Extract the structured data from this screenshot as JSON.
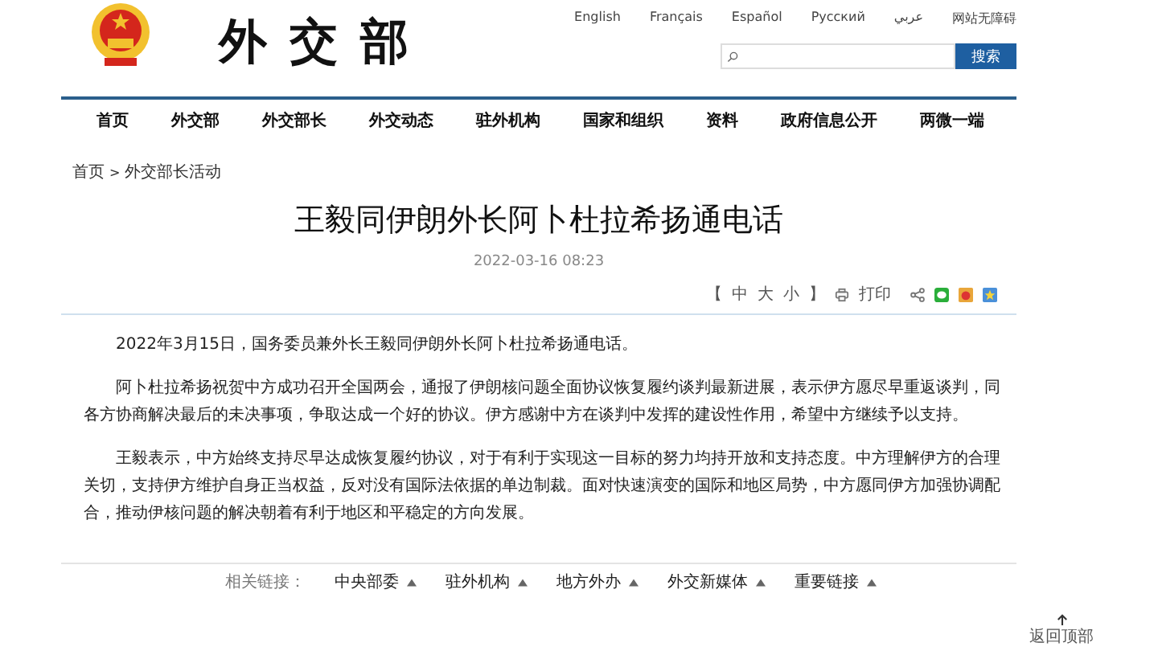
{
  "header": {
    "logo_text": "外交部",
    "languages": [
      "English",
      "Français",
      "Español",
      "Русский",
      "عربي",
      "网站无障碍"
    ],
    "search": {
      "button": "搜索"
    }
  },
  "nav": [
    {
      "label": "首页",
      "selected": false
    },
    {
      "label": "外交部",
      "selected": false
    },
    {
      "label": "外交部长",
      "selected": false
    },
    {
      "label": "外交动态",
      "selected": false
    },
    {
      "label": "驻外机构",
      "selected": false
    },
    {
      "label": "国家和组织",
      "selected": false
    },
    {
      "label": "资料",
      "selected": false
    },
    {
      "label": "政府信息公开",
      "selected": false
    },
    {
      "label": "两微一端",
      "selected": false
    }
  ],
  "breadcrumb": [
    "首页",
    "外交部长活动"
  ],
  "breadcrumb_separator": ">",
  "article": {
    "title": "王毅同伊朗外长阿卜杜拉希扬通电话",
    "date": "2022-03-16 08:23",
    "font_size": {
      "open": "【",
      "options": [
        "中",
        "大",
        "小"
      ],
      "close": "】"
    },
    "print": "打印",
    "paragraphs": [
      "2022年3月15日，国务委员兼外长王毅同伊朗外长阿卜杜拉希扬通电话。",
      "阿卜杜拉希扬祝贺中方成功召开全国两会，通报了伊朗核问题全面协议恢复履约谈判最新进展，表示伊方愿尽早重返谈判，同各方协商解决最后的未决事项，争取达成一个好的协议。伊方感谢中方在谈判中发挥的建设性作用，希望中方继续予以支持。",
      "王毅表示，中方始终支持尽早达成恢复履约协议，对于有利于实现这一目标的努力均持开放和支持态度。中方理解伊方的合理关切，支持伊方维护自身正当权益，反对没有国际法依据的单边制裁。面对快速演变的国际和地区局势，中方愿同伊方加强协调配合，推动伊核问题的解决朝着有利于地区和平稳定的方向发展。"
    ]
  },
  "footer": {
    "label": "相关链接：",
    "links": [
      "中央部委",
      "驻外机构",
      "地方外办",
      "外交新媒体",
      "重要链接"
    ],
    "back_to_top": "返回顶部"
  }
}
